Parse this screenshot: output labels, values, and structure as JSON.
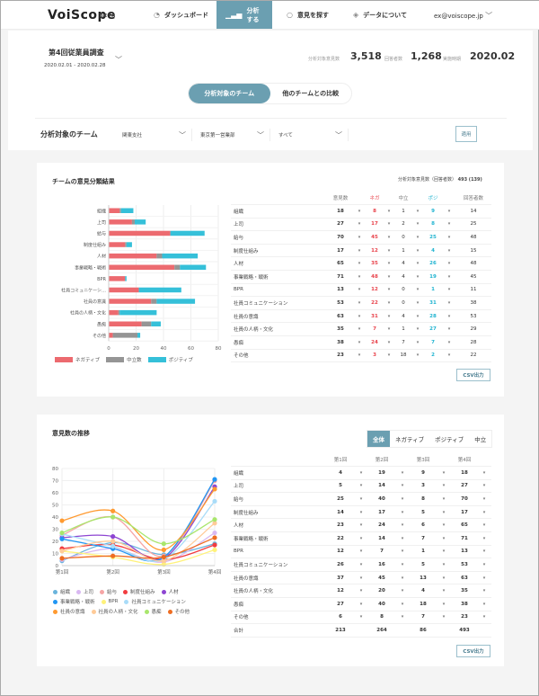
{
  "header": {
    "logo": "VoiScope",
    "beta": "BETA",
    "nav": [
      {
        "label": "ダッシュボード",
        "icon": "gauge-icon"
      },
      {
        "label": "分析する",
        "icon": "bar-chart-icon",
        "active": true
      },
      {
        "label": "意見を探す",
        "icon": "speech-bubble-icon"
      },
      {
        "label": "データについて",
        "icon": "layers-icon"
      }
    ],
    "user": "ex@voiscope.jp"
  },
  "survey": {
    "title": "第4回従業員調査",
    "dates": "2020.02.01 - 2020.02.28",
    "stats": [
      {
        "label": "分析対象意見数",
        "value": "3,518"
      },
      {
        "label": "回答者数",
        "value": "1,268"
      },
      {
        "label": "実施時期",
        "value": "2020.02"
      }
    ]
  },
  "toggle": {
    "options": [
      "分析対象のチーム",
      "他のチームとの比較"
    ],
    "active": 0
  },
  "filter": {
    "label": "分析対象のチーム",
    "selects": [
      "関東支社",
      "東京第一営業部",
      "すべて"
    ],
    "apply": "適用"
  },
  "colors": {
    "accent": "#6b9fb1",
    "negative": "#e8414a",
    "neutral": "#8a8a8a",
    "positive": "#1fb3d0"
  },
  "classification": {
    "title": "チームの意見分類結果",
    "summary_label": "分析対象意見数（回答者数）",
    "summary_value": "493 (139)",
    "headers": [
      "意見数",
      "ネガ",
      "中立",
      "ポジ",
      "回答者数"
    ],
    "rows": [
      {
        "label": "組織",
        "chart_label": "組織",
        "total": 18,
        "neg": 8,
        "neu": 1,
        "pos": 9,
        "resp": 14
      },
      {
        "label": "上司",
        "chart_label": "上司",
        "total": 27,
        "neg": 17,
        "neu": 2,
        "pos": 8,
        "resp": 25
      },
      {
        "label": "給与",
        "chart_label": "給与",
        "total": 70,
        "neg": 45,
        "neu": 0,
        "pos": 25,
        "resp": 48
      },
      {
        "label": "制度仕組み",
        "chart_label": "制度仕組み",
        "total": 17,
        "neg": 12,
        "neu": 1,
        "pos": 4,
        "resp": 15
      },
      {
        "label": "人材",
        "chart_label": "人材",
        "total": 65,
        "neg": 35,
        "neu": 4,
        "pos": 26,
        "resp": 48
      },
      {
        "label": "事業戦略・戦術",
        "chart_label": "事業戦略・戦術",
        "total": 71,
        "neg": 48,
        "neu": 4,
        "pos": 19,
        "resp": 45
      },
      {
        "label": "BPR",
        "chart_label": "BPR",
        "total": 13,
        "neg": 12,
        "neu": 0,
        "pos": 1,
        "resp": 11
      },
      {
        "label": "社員コミュニケーション",
        "chart_label": "社員コミュニケーシ…",
        "total": 53,
        "neg": 22,
        "neu": 0,
        "pos": 31,
        "resp": 38
      },
      {
        "label": "社員の意識",
        "chart_label": "社員の意識",
        "total": 63,
        "neg": 31,
        "neu": 4,
        "pos": 28,
        "resp": 53
      },
      {
        "label": "社員の人柄・文化",
        "chart_label": "社員の人柄・文化",
        "total": 35,
        "neg": 7,
        "neu": 1,
        "pos": 27,
        "resp": 29
      },
      {
        "label": "愚痴",
        "chart_label": "愚痴",
        "total": 38,
        "neg": 24,
        "neu": 7,
        "pos": 7,
        "resp": 28
      },
      {
        "label": "その他",
        "chart_label": "その他",
        "total": 23,
        "neg": 3,
        "neu": 18,
        "pos": 2,
        "resp": 22
      }
    ],
    "csv": "CSV出力"
  },
  "trend": {
    "title": "意見数の推移",
    "tabs": [
      "全体",
      "ネガティブ",
      "ポジティブ",
      "中立"
    ],
    "active_tab": 0,
    "headers": [
      "第1回",
      "第2回",
      "第3回",
      "第4回"
    ],
    "total_label": "合計",
    "totals": [
      213,
      264,
      86,
      493
    ],
    "csv": "CSV出力"
  },
  "chart_data": [
    {
      "type": "bar",
      "stacked": true,
      "orientation": "horizontal",
      "title": "チームの意見分類結果",
      "categories": [
        "組織",
        "上司",
        "給与",
        "制度仕組み",
        "人材",
        "事業戦略・戦術",
        "BPR",
        "社員コミュニケーシ…",
        "社員の意識",
        "社員の人柄・文化",
        "愚痴",
        "その他"
      ],
      "series": [
        {
          "name": "ネガティブ",
          "color": "#ec6a6f",
          "values": [
            8,
            17,
            45,
            12,
            35,
            48,
            12,
            22,
            31,
            7,
            24,
            3
          ]
        },
        {
          "name": "中立数",
          "color": "#959595",
          "values": [
            1,
            2,
            0,
            1,
            4,
            4,
            0,
            0,
            4,
            1,
            7,
            18
          ]
        },
        {
          "name": "ポジティブ",
          "color": "#35c0d9",
          "values": [
            9,
            8,
            25,
            4,
            26,
            19,
            1,
            31,
            28,
            27,
            7,
            2
          ]
        }
      ],
      "xlim": [
        0,
        80
      ],
      "xticks": [
        0,
        20,
        40,
        60,
        80
      ],
      "legend": "bottom-left"
    },
    {
      "type": "line",
      "title": "意見数の推移",
      "x": [
        "第1回",
        "第2回",
        "第3回",
        "第4回"
      ],
      "ylim": [
        0,
        80
      ],
      "yticks": [
        0,
        10,
        20,
        30,
        40,
        50,
        60,
        70,
        80
      ],
      "legend": "bottom",
      "series": [
        {
          "name": "組織",
          "color": "#6ab4dc",
          "values": [
            4,
            19,
            9,
            18
          ]
        },
        {
          "name": "上司",
          "color": "#d9b8f2",
          "values": [
            5,
            14,
            3,
            27
          ]
        },
        {
          "name": "給与",
          "color": "#f6a5a5",
          "values": [
            25,
            40,
            8,
            70
          ]
        },
        {
          "name": "制度仕組み",
          "color": "#f23c40",
          "values": [
            14,
            17,
            5,
            17
          ]
        },
        {
          "name": "人材",
          "color": "#8d45d2",
          "values": [
            23,
            24,
            6,
            65
          ]
        },
        {
          "name": "事業戦略・戦術",
          "color": "#2196f3",
          "values": [
            22,
            14,
            7,
            71
          ]
        },
        {
          "name": "BPR",
          "color": "#fff27a",
          "values": [
            12,
            7,
            1,
            13
          ]
        },
        {
          "name": "社員コミュニケーション",
          "color": "#a9dcf8",
          "values": [
            26,
            16,
            5,
            53
          ]
        },
        {
          "name": "社員の意識",
          "color": "#ff9a30",
          "values": [
            37,
            45,
            13,
            63
          ]
        },
        {
          "name": "社員の人柄・文化",
          "color": "#ffcb98",
          "values": [
            12,
            20,
            4,
            35
          ]
        },
        {
          "name": "愚痴",
          "color": "#a9e66c",
          "values": [
            27,
            40,
            18,
            38
          ]
        },
        {
          "name": "その他",
          "color": "#ee6d22",
          "values": [
            6,
            8,
            7,
            23
          ]
        }
      ]
    }
  ]
}
